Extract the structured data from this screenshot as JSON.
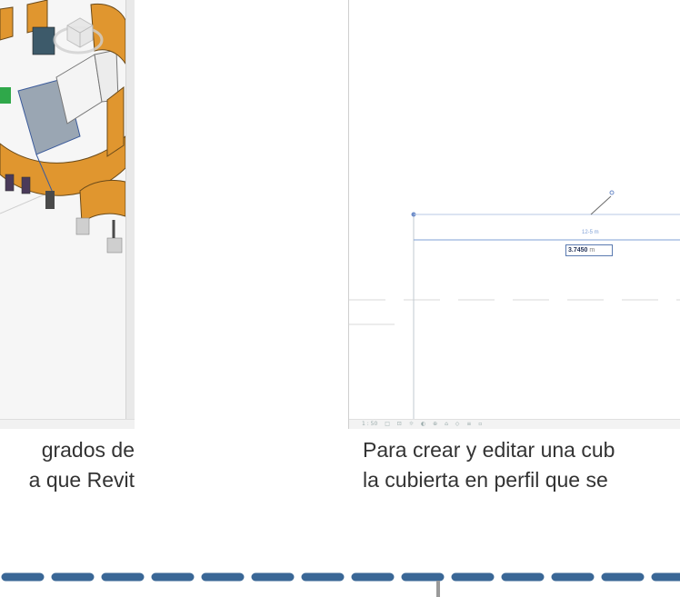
{
  "captions": {
    "left": [
      "grados de",
      "a que Revit"
    ],
    "right": [
      "Para crear y editar una cub",
      "la cubierta en perfil que se"
    ]
  },
  "drawing": {
    "dimension_label": "12-5 m",
    "dimension_value": "3.7450",
    "dimension_unit": "m",
    "status_scale": "1 : 50"
  },
  "colors": {
    "wall_orange": "#e0962f",
    "dashed_rule": "#3a6796",
    "caption_text": "#333333"
  },
  "icons": [
    "viewcube-icon",
    "dimension-lock-icon"
  ]
}
